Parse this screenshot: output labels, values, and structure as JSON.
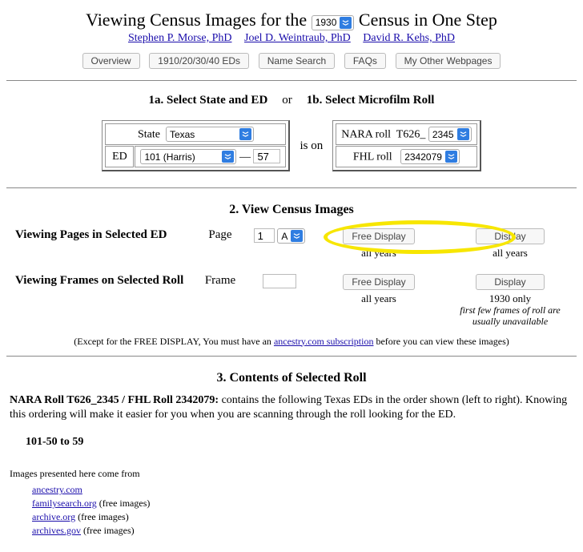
{
  "header": {
    "title_pre": "Viewing Census Images for the",
    "title_post": "Census in One Step",
    "year": "1930",
    "authors": [
      "Stephen P. Morse, PhD",
      "Joel D. Weintraub, PhD",
      "David R. Kehs, PhD"
    ]
  },
  "toolbar": {
    "overview": "Overview",
    "eds": "1910/20/30/40 EDs",
    "name_search": "Name Search",
    "faqs": "FAQs",
    "other": "My Other Webpages"
  },
  "section1": {
    "title_a": "1a. Select State and ED",
    "or": "or",
    "title_b": "1b. Select Microfilm Roll",
    "state_label": "State",
    "state_value": "Texas",
    "ed_label": "ED",
    "ed_value": "101 (Harris)",
    "ed_dash": "—",
    "ed_sub": "57",
    "is_on": "is on",
    "nara_label": "NARA roll",
    "nara_prefix": "T626_",
    "nara_num": "2345",
    "fhl_label": "FHL roll",
    "fhl_value": "2342079"
  },
  "section2": {
    "title": "2. View Census Images",
    "pages_label": "Viewing Pages in Selected ED",
    "page_label": "Page",
    "page_value": "1",
    "page_side": "A",
    "free_display": "Free Display",
    "display": "Display",
    "all_years": "all years",
    "frames_label": "Viewing Frames on Selected Roll",
    "frame_label": "Frame",
    "year_only": "1930 only",
    "frame_note": "first few frames of roll are usually unavailable",
    "disclaimer_pre": "(Except for the FREE DISPLAY, You must have an ",
    "disclaimer_link": "ancestry.com subscription",
    "disclaimer_post": " before you can view these images)"
  },
  "section3": {
    "title": "3. Contents of Selected Roll",
    "summary_bold": "NARA Roll T626_2345 / FHL Roll 2342079:",
    "summary_rest": " contains the following Texas EDs in the order shown (left to right). Knowing this ordering will make it easier for you when you are scanning through the roll looking for the ED.",
    "ed_range": "101-50 to 59"
  },
  "footer": {
    "intro": "Images presented here come from",
    "links": [
      {
        "name": "ancestry.com",
        "suffix": ""
      },
      {
        "name": "familysearch.org",
        "suffix": " (free images)"
      },
      {
        "name": "archive.org",
        "suffix": " (free images)"
      },
      {
        "name": "archives.gov",
        "suffix": " (free images)"
      }
    ]
  }
}
